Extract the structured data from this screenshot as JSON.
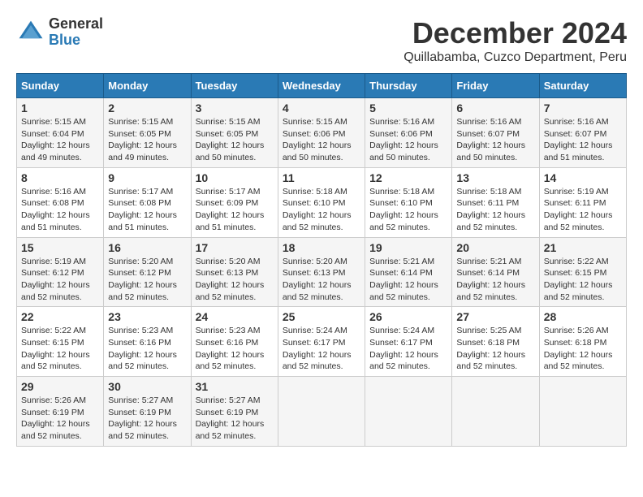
{
  "header": {
    "logo_general": "General",
    "logo_blue": "Blue",
    "title": "December 2024",
    "subtitle": "Quillabamba, Cuzco Department, Peru"
  },
  "calendar": {
    "days_of_week": [
      "Sunday",
      "Monday",
      "Tuesday",
      "Wednesday",
      "Thursday",
      "Friday",
      "Saturday"
    ],
    "weeks": [
      [
        null,
        {
          "day": "2",
          "sunrise": "5:15 AM",
          "sunset": "6:05 PM",
          "daylight": "12 hours and 49 minutes."
        },
        {
          "day": "3",
          "sunrise": "5:15 AM",
          "sunset": "6:05 PM",
          "daylight": "12 hours and 50 minutes."
        },
        {
          "day": "4",
          "sunrise": "5:15 AM",
          "sunset": "6:06 PM",
          "daylight": "12 hours and 50 minutes."
        },
        {
          "day": "5",
          "sunrise": "5:16 AM",
          "sunset": "6:06 PM",
          "daylight": "12 hours and 50 minutes."
        },
        {
          "day": "6",
          "sunrise": "5:16 AM",
          "sunset": "6:07 PM",
          "daylight": "12 hours and 50 minutes."
        },
        {
          "day": "7",
          "sunrise": "5:16 AM",
          "sunset": "6:07 PM",
          "daylight": "12 hours and 51 minutes."
        }
      ],
      [
        {
          "day": "1",
          "sunrise": "5:15 AM",
          "sunset": "6:04 PM",
          "daylight": "12 hours and 49 minutes."
        },
        {
          "day": "9",
          "sunrise": "5:17 AM",
          "sunset": "6:08 PM",
          "daylight": "12 hours and 51 minutes."
        },
        {
          "day": "10",
          "sunrise": "5:17 AM",
          "sunset": "6:09 PM",
          "daylight": "12 hours and 51 minutes."
        },
        {
          "day": "11",
          "sunrise": "5:18 AM",
          "sunset": "6:10 PM",
          "daylight": "12 hours and 52 minutes."
        },
        {
          "day": "12",
          "sunrise": "5:18 AM",
          "sunset": "6:10 PM",
          "daylight": "12 hours and 52 minutes."
        },
        {
          "day": "13",
          "sunrise": "5:18 AM",
          "sunset": "6:11 PM",
          "daylight": "12 hours and 52 minutes."
        },
        {
          "day": "14",
          "sunrise": "5:19 AM",
          "sunset": "6:11 PM",
          "daylight": "12 hours and 52 minutes."
        }
      ],
      [
        {
          "day": "8",
          "sunrise": "5:16 AM",
          "sunset": "6:08 PM",
          "daylight": "12 hours and 51 minutes."
        },
        {
          "day": "16",
          "sunrise": "5:20 AM",
          "sunset": "6:12 PM",
          "daylight": "12 hours and 52 minutes."
        },
        {
          "day": "17",
          "sunrise": "5:20 AM",
          "sunset": "6:13 PM",
          "daylight": "12 hours and 52 minutes."
        },
        {
          "day": "18",
          "sunrise": "5:20 AM",
          "sunset": "6:13 PM",
          "daylight": "12 hours and 52 minutes."
        },
        {
          "day": "19",
          "sunrise": "5:21 AM",
          "sunset": "6:14 PM",
          "daylight": "12 hours and 52 minutes."
        },
        {
          "day": "20",
          "sunrise": "5:21 AM",
          "sunset": "6:14 PM",
          "daylight": "12 hours and 52 minutes."
        },
        {
          "day": "21",
          "sunrise": "5:22 AM",
          "sunset": "6:15 PM",
          "daylight": "12 hours and 52 minutes."
        }
      ],
      [
        {
          "day": "15",
          "sunrise": "5:19 AM",
          "sunset": "6:12 PM",
          "daylight": "12 hours and 52 minutes."
        },
        {
          "day": "23",
          "sunrise": "5:23 AM",
          "sunset": "6:16 PM",
          "daylight": "12 hours and 52 minutes."
        },
        {
          "day": "24",
          "sunrise": "5:23 AM",
          "sunset": "6:16 PM",
          "daylight": "12 hours and 52 minutes."
        },
        {
          "day": "25",
          "sunrise": "5:24 AM",
          "sunset": "6:17 PM",
          "daylight": "12 hours and 52 minutes."
        },
        {
          "day": "26",
          "sunrise": "5:24 AM",
          "sunset": "6:17 PM",
          "daylight": "12 hours and 52 minutes."
        },
        {
          "day": "27",
          "sunrise": "5:25 AM",
          "sunset": "6:18 PM",
          "daylight": "12 hours and 52 minutes."
        },
        {
          "day": "28",
          "sunrise": "5:26 AM",
          "sunset": "6:18 PM",
          "daylight": "12 hours and 52 minutes."
        }
      ],
      [
        {
          "day": "22",
          "sunrise": "5:22 AM",
          "sunset": "6:15 PM",
          "daylight": "12 hours and 52 minutes."
        },
        {
          "day": "30",
          "sunrise": "5:27 AM",
          "sunset": "6:19 PM",
          "daylight": "12 hours and 52 minutes."
        },
        {
          "day": "31",
          "sunrise": "5:27 AM",
          "sunset": "6:19 PM",
          "daylight": "12 hours and 52 minutes."
        },
        null,
        null,
        null,
        null
      ],
      [
        {
          "day": "29",
          "sunrise": "5:26 AM",
          "sunset": "6:19 PM",
          "daylight": "12 hours and 52 minutes."
        },
        null,
        null,
        null,
        null,
        null,
        null
      ]
    ]
  }
}
